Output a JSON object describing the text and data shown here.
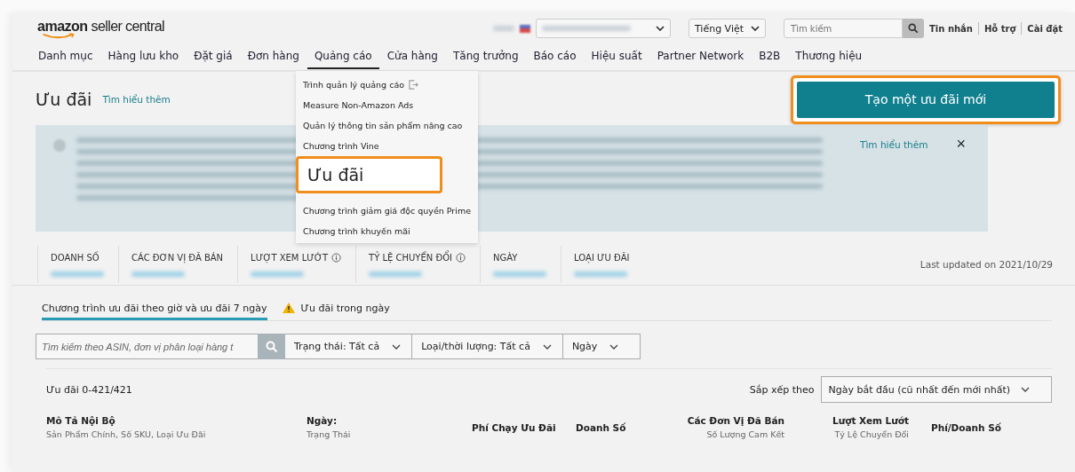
{
  "header": {
    "logo": {
      "brand": "amazon",
      "product": "seller central"
    },
    "language": "Tiếng Việt",
    "search": {
      "placeholder": "Tìm kiếm"
    },
    "links": [
      "Tin nhắn",
      "Hỗ trợ",
      "Cài đặt"
    ]
  },
  "nav": [
    {
      "label": "Danh mục",
      "selected": false
    },
    {
      "label": "Hàng lưu kho",
      "selected": false
    },
    {
      "label": "Đặt giá",
      "selected": false
    },
    {
      "label": "Đơn hàng",
      "selected": false
    },
    {
      "label": "Quảng cáo",
      "selected": true
    },
    {
      "label": "Cửa hàng",
      "selected": false
    },
    {
      "label": "Tăng trưởng",
      "selected": false
    },
    {
      "label": "Báo cáo",
      "selected": false
    },
    {
      "label": "Hiệu suất",
      "selected": false
    },
    {
      "label": "Partner Network",
      "selected": false
    },
    {
      "label": "B2B",
      "selected": false
    },
    {
      "label": "Thương hiệu",
      "selected": false
    }
  ],
  "menu": [
    {
      "label": "Trình quản lý quảng cáo",
      "external": true,
      "highlighted": false
    },
    {
      "label": "Measure Non-Amazon Ads",
      "external": false,
      "highlighted": false
    },
    {
      "label": "Quản lý thông tin sản phẩm nâng cao",
      "external": false,
      "highlighted": false
    },
    {
      "label": "Chương trình Vine",
      "external": false,
      "highlighted": false
    },
    {
      "label": "Ưu đãi",
      "external": false,
      "highlighted": true
    },
    {
      "label": "Chương trình giảm giá độc quyền Prime",
      "external": false,
      "highlighted": false
    },
    {
      "label": "Chương trình khuyến mãi",
      "external": false,
      "highlighted": false
    }
  ],
  "page": {
    "title": "Ưu đãi",
    "learn_more": "Tìm hiểu thêm",
    "create_button": "Tạo một ưu đãi mới"
  },
  "banner": {
    "learn_more": "Tìm hiểu thêm",
    "close": "×"
  },
  "stats": [
    {
      "label": "DOANH SỐ",
      "info": false
    },
    {
      "label": "CÁC ĐƠN VỊ ĐÃ BÁN",
      "info": false
    },
    {
      "label": "LƯỢT XEM LƯỚT",
      "info": true
    },
    {
      "label": "TỶ LỆ CHUYỂN ĐỔI",
      "info": true
    },
    {
      "label": "NGÀY",
      "info": false
    },
    {
      "label": "LOẠI ƯU ĐÃI",
      "info": false
    }
  ],
  "last_updated": "Last updated on 2021/10/29",
  "tabs": [
    {
      "label": "Chương trình ưu đãi theo giờ và ưu đãi 7 ngày",
      "selected": true,
      "warning": false
    },
    {
      "label": "Ưu đãi trong ngày",
      "selected": false,
      "warning": true
    }
  ],
  "filters": {
    "search": {
      "placeholder": "Tìm kiếm theo ASIN, đơn vị phân loại hàng t"
    },
    "dropdowns": [
      "Trạng thái: Tất cả",
      "Loại/thời lượng: Tất cả",
      "Ngày"
    ]
  },
  "count": "Ưu đãi 0-421/421",
  "sort": {
    "label": "Sắp xếp theo",
    "value": "Ngày bắt đầu (cũ nhất đến mới nhất)"
  },
  "columns": [
    {
      "title": "Mô Tả Nội Bộ",
      "subtitle": "Sản Phẩm Chính, Số SKU, Loại Ưu Đãi"
    },
    {
      "title": "Ngày:",
      "subtitle": "Trạng Thái"
    },
    {
      "title": "Phí Chạy Ưu Đãi"
    },
    {
      "title": "Doanh Số"
    },
    {
      "title": "Các Đơn Vị Đã Bán",
      "subtitle": "Số Lượng Cam Kết"
    },
    {
      "title": "Lượt Xem Lướt",
      "subtitle": "Tỷ Lệ Chuyển Đổi"
    },
    {
      "title": "Phí/Doanh Số"
    }
  ]
}
